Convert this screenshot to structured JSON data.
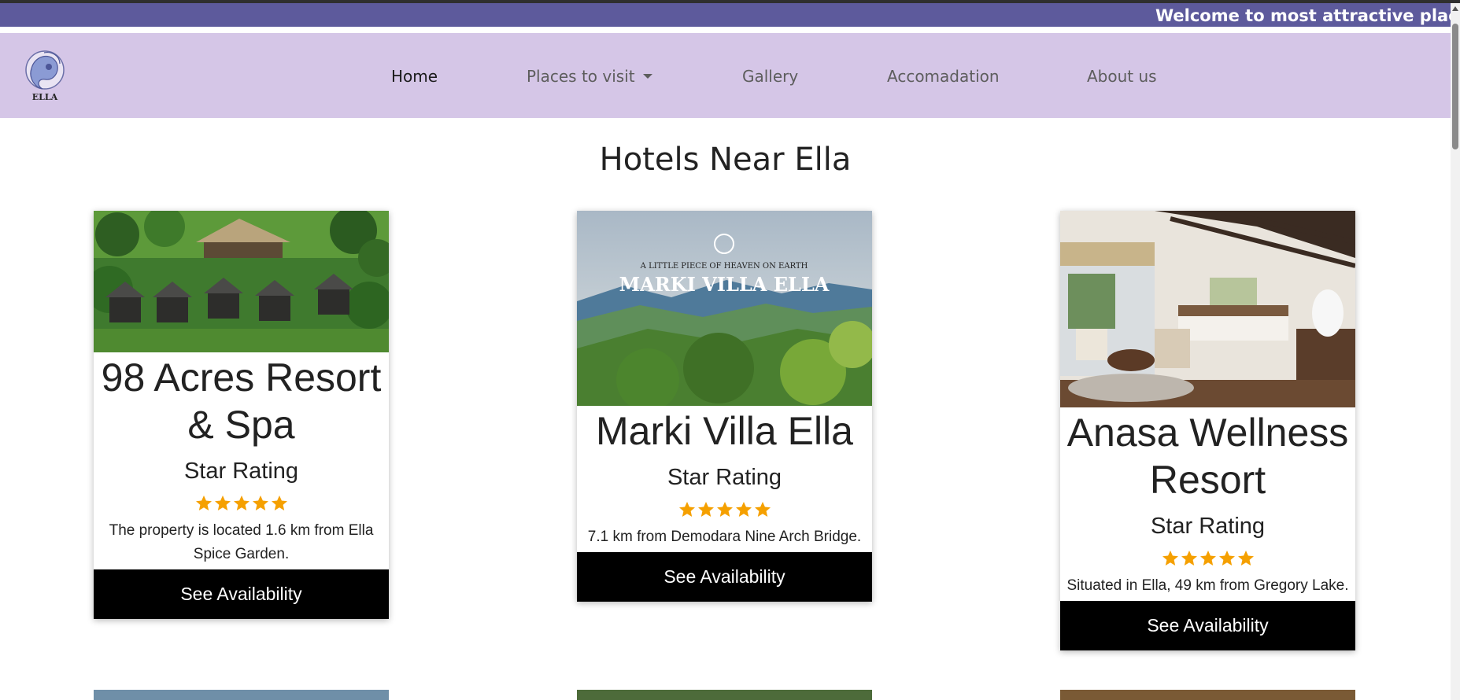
{
  "marquee": {
    "text": "Welcome to most attractive place"
  },
  "brand": {
    "logo_text": "ELLA"
  },
  "nav": {
    "items": [
      {
        "label": "Home"
      },
      {
        "label": "Places to visit"
      },
      {
        "label": "Gallery"
      },
      {
        "label": "Accomadation"
      },
      {
        "label": "About us"
      }
    ]
  },
  "main": {
    "title": "Hotels Near Ella",
    "hotels": [
      {
        "name": "98 Acres Resort & Spa",
        "rating_label": "Star Rating",
        "stars": 5,
        "description": "The property is located 1.6 km from Ella Spice Garden.",
        "button": "See Availability"
      },
      {
        "name": "Marki Villa Ella",
        "image_tagline": "A LITTLE PIECE OF HEAVEN ON EARTH",
        "image_title": "MARKI VILLA ELLA",
        "rating_label": "Star Rating",
        "stars": 5,
        "description": "7.1 km from Demodara Nine Arch Bridge.",
        "button": "See Availability"
      },
      {
        "name": "Anasa Wellness Resort",
        "rating_label": "Star Rating",
        "stars": 5,
        "description": "Situated in Ella, 49 km from Gregory Lake.",
        "button": "See Availability"
      }
    ]
  },
  "colors": {
    "marquee_bg": "#5d5a9c",
    "navbar_bg": "#d5c6e7",
    "star": "#f5a000",
    "button_bg": "#000000"
  }
}
